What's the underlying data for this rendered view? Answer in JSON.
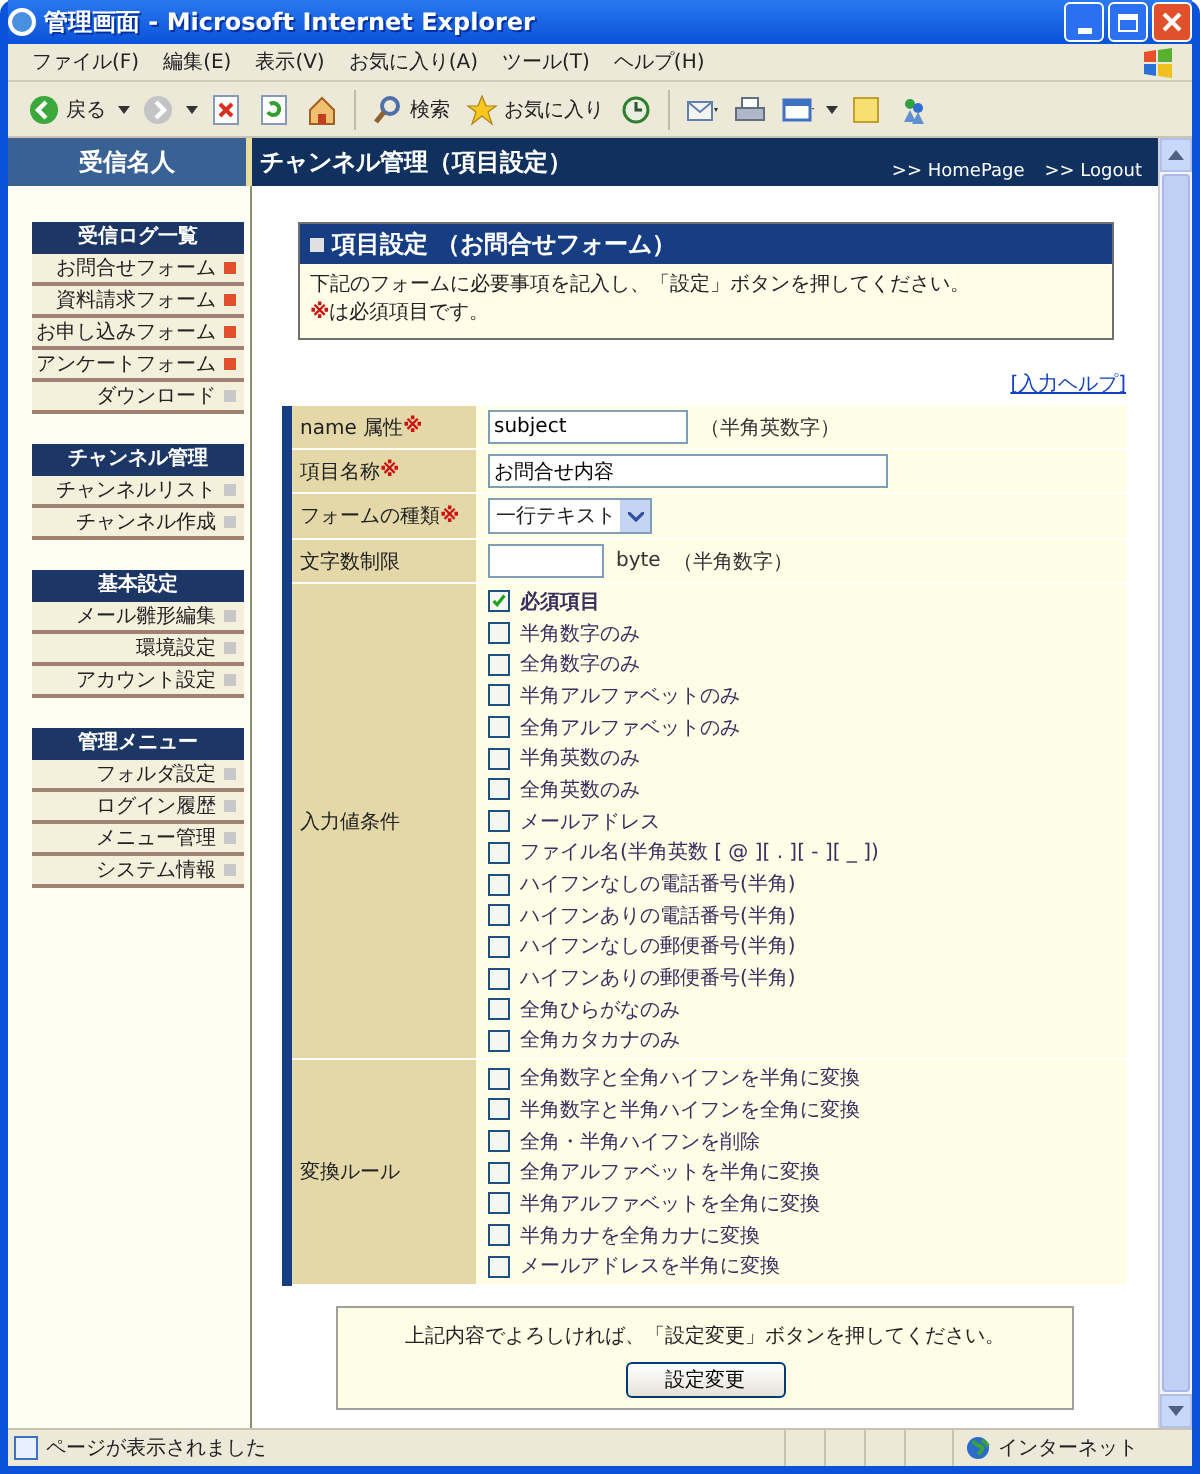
{
  "window": {
    "title": "管理画面 - Microsoft Internet Explorer"
  },
  "menu": [
    "ファイル(F)",
    "編集(E)",
    "表示(V)",
    "お気に入り(A)",
    "ツール(T)",
    "ヘルプ(H)"
  ],
  "toolbar": [
    {
      "kind": "back",
      "label": "戻る"
    },
    {
      "kind": "forward"
    },
    {
      "kind": "stop"
    },
    {
      "kind": "refresh"
    },
    {
      "kind": "home"
    },
    {
      "kind": "search",
      "label": "検索"
    },
    {
      "kind": "favorites",
      "label": "お気に入り"
    },
    {
      "kind": "history"
    },
    {
      "kind": "mail"
    },
    {
      "kind": "print"
    },
    {
      "kind": "edit"
    },
    {
      "kind": "note"
    },
    {
      "kind": "messenger"
    }
  ],
  "header": {
    "site_name": "受信名人",
    "page_title": "チャンネル管理（項目設定）",
    "links": [
      ">> HomePage",
      ">> Logout"
    ]
  },
  "sidebar": {
    "sections": [
      {
        "title": "受信ログ一覧",
        "items": [
          {
            "label": "お問合せフォーム",
            "color": "#e0502a"
          },
          {
            "label": "資料請求フォーム",
            "color": "#e0502a"
          },
          {
            "label": "お申し込みフォーム",
            "color": "#e0502a"
          },
          {
            "label": "アンケートフォーム",
            "color": "#e0502a"
          },
          {
            "label": "ダウンロード",
            "color": "#c8c8c8"
          }
        ]
      },
      {
        "title": "チャンネル管理",
        "items": [
          {
            "label": "チャンネルリスト",
            "color": "#c8c8c8"
          },
          {
            "label": "チャンネル作成",
            "color": "#c8c8c8"
          }
        ]
      },
      {
        "title": "基本設定",
        "items": [
          {
            "label": "メール雛形編集",
            "color": "#c8c8c8"
          },
          {
            "label": "環境設定",
            "color": "#c8c8c8"
          },
          {
            "label": "アカウント設定",
            "color": "#c8c8c8"
          }
        ]
      },
      {
        "title": "管理メニュー",
        "items": [
          {
            "label": "フォルダ設定",
            "color": "#c8c8c8"
          },
          {
            "label": "ログイン履歴",
            "color": "#c8c8c8"
          },
          {
            "label": "メニュー管理",
            "color": "#c8c8c8"
          },
          {
            "label": "システム情報",
            "color": "#c8c8c8"
          }
        ]
      }
    ]
  },
  "notice": {
    "title": "項目設定 （お問合せフォーム）",
    "text": "下記のフォームに必要事項を記入し、「設定」ボタンを押してください。",
    "mark": "※",
    "mark_text": "は必須項目です。"
  },
  "help_link": "[入力ヘルプ]",
  "form": {
    "rows": [
      {
        "kind": "text",
        "label": "name 属性",
        "mark": "※",
        "value": "subject",
        "hint": "（半角英数字）"
      },
      {
        "kind": "wide",
        "label": "項目名称",
        "mark": "※",
        "value": "お問合せ内容"
      },
      {
        "kind": "select",
        "label": "フォームの種類",
        "mark": "※",
        "value": "一行テキスト"
      },
      {
        "kind": "number",
        "label": "文字数制限",
        "unit": "byte",
        "hint": "（半角数字）"
      },
      {
        "kind": "checklist",
        "label": "入力値条件",
        "options": [
          {
            "label": "必須項目",
            "checked": true
          },
          {
            "label": "半角数字のみ",
            "checked": false
          },
          {
            "label": "全角数字のみ",
            "checked": false
          },
          {
            "label": "半角アルファベットのみ",
            "checked": false
          },
          {
            "label": "全角アルファベットのみ",
            "checked": false
          },
          {
            "label": "半角英数のみ",
            "checked": false
          },
          {
            "label": "全角英数のみ",
            "checked": false
          },
          {
            "label": "メールアドレス",
            "checked": false
          },
          {
            "label": "ファイル名(半角英数 [ @ ][ . ][ - ][ _ ])",
            "checked": false
          },
          {
            "label": "ハイフンなしの電話番号(半角)",
            "checked": false
          },
          {
            "label": "ハイフンありの電話番号(半角)",
            "checked": false
          },
          {
            "label": "ハイフンなしの郵便番号(半角)",
            "checked": false
          },
          {
            "label": "ハイフンありの郵便番号(半角)",
            "checked": false
          },
          {
            "label": "全角ひらがなのみ",
            "checked": false
          },
          {
            "label": "全角カタカナのみ",
            "checked": false
          }
        ]
      },
      {
        "kind": "checklist",
        "label": "変換ルール",
        "options": [
          {
            "label": "全角数字と全角ハイフンを半角に変換",
            "checked": false
          },
          {
            "label": "半角数字と半角ハイフンを全角に変換",
            "checked": false
          },
          {
            "label": "全角・半角ハイフンを削除",
            "checked": false
          },
          {
            "label": "全角アルファベットを半角に変換",
            "checked": false
          },
          {
            "label": "半角アルファベットを全角に変換",
            "checked": false
          },
          {
            "label": "半角カナを全角カナに変換",
            "checked": false
          },
          {
            "label": "メールアドレスを半角に変換",
            "checked": false
          }
        ]
      }
    ]
  },
  "footer": {
    "message": "上記内容でよろしければ、「設定変更」ボタンを押してください。",
    "button": "設定変更"
  },
  "status_bar": {
    "message": "ページが表示されました",
    "zone": "インターネット"
  }
}
